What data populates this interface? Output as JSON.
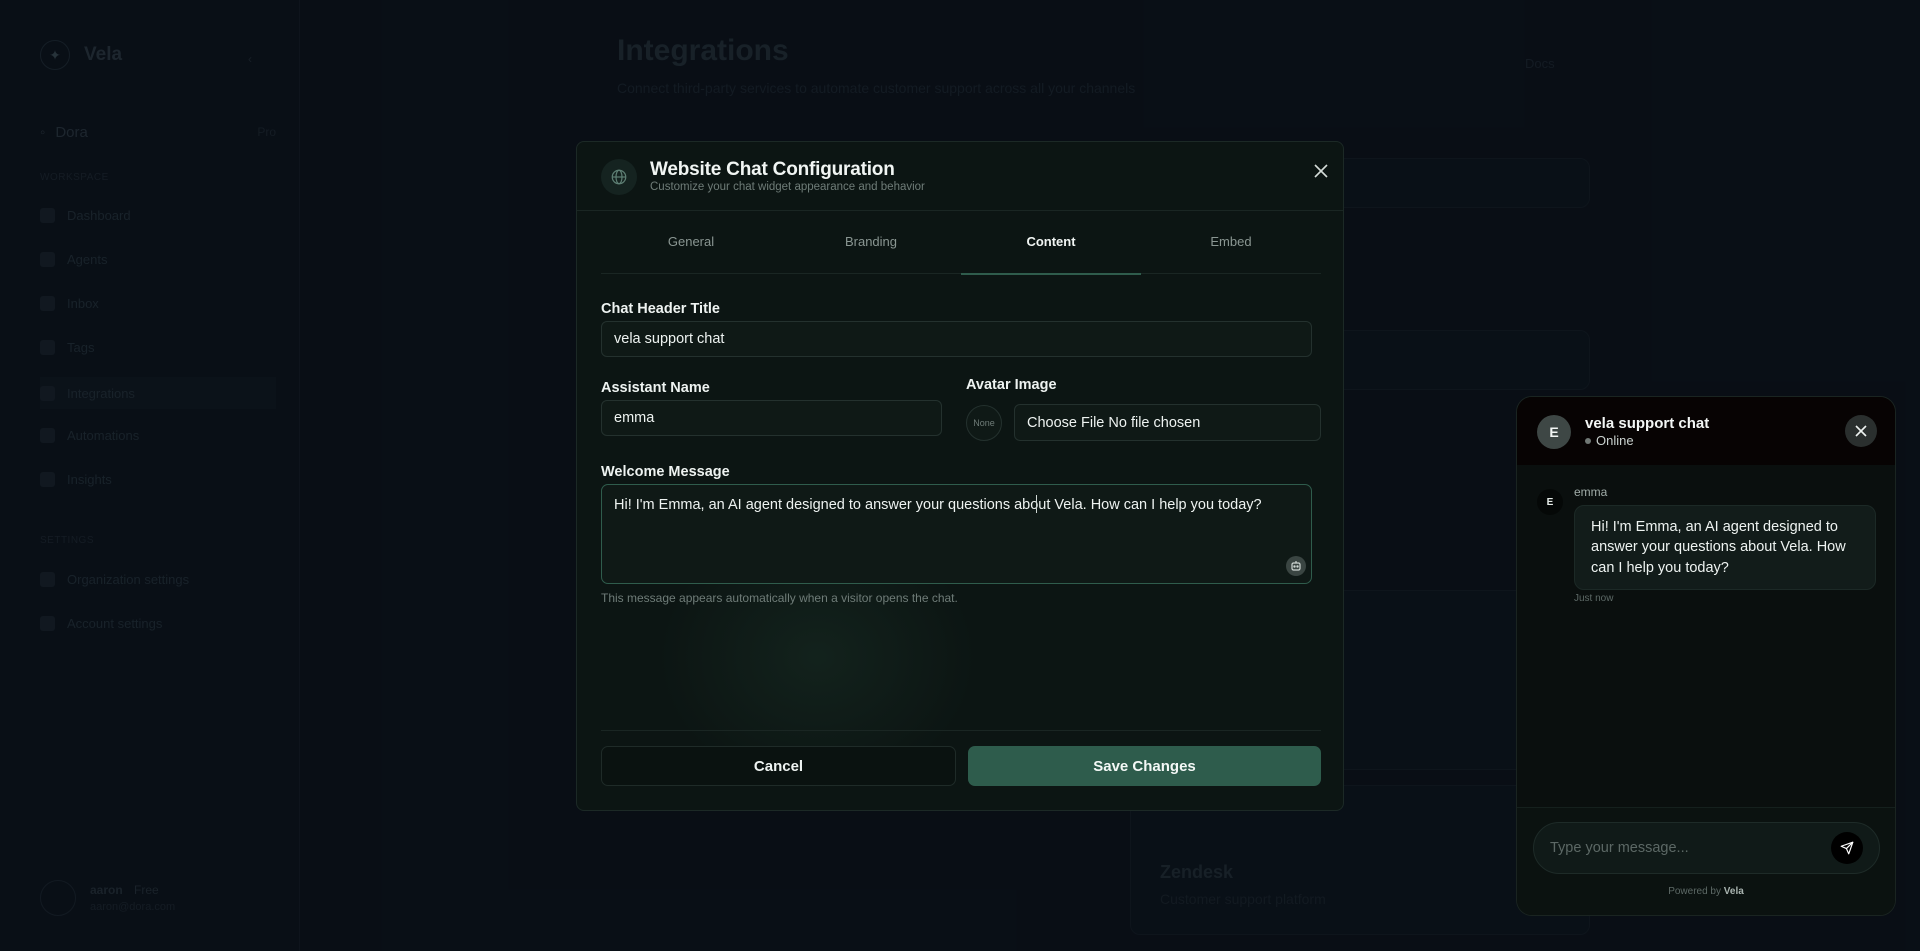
{
  "background": {
    "sidebar": {
      "brand": "Vela",
      "workspace": {
        "name": "Dora",
        "plan": "Pro"
      },
      "sections": [
        "WORKSPACE",
        "SETTINGS"
      ],
      "items": [
        "Dashboard",
        "Agents",
        "Inbox",
        "Tags",
        "Integrations",
        "Automations",
        "Insights"
      ],
      "settings_items": [
        "Organization settings",
        "Account settings"
      ],
      "user": {
        "name": "aaron",
        "plan": "Free",
        "email": "aaron@dora.com"
      }
    },
    "page": {
      "title": "Integrations",
      "subtitle": "Connect third-party services to automate customer support across all your channels",
      "action": "Docs",
      "card_title": "Zendesk",
      "card_desc": "Customer support platform"
    }
  },
  "modal": {
    "title": "Website Chat Configuration",
    "subtitle": "Customize your chat widget appearance and behavior",
    "tabs": [
      {
        "label": "General",
        "active": false
      },
      {
        "label": "Branding",
        "active": false
      },
      {
        "label": "Content",
        "active": true
      },
      {
        "label": "Embed",
        "active": false
      }
    ],
    "fields": {
      "chat_header_title": {
        "label": "Chat Header Title",
        "value": "vela support chat"
      },
      "assistant_name": {
        "label": "Assistant Name",
        "value": "emma"
      },
      "avatar_image": {
        "label": "Avatar Image",
        "placeholder": "None",
        "button": "Choose File",
        "status": "No file chosen"
      },
      "welcome_message": {
        "label": "Welcome Message",
        "value": "Hi! I'm Emma, an AI agent designed to answer your questions about Vela. How can I help you today?",
        "helper": "This message appears automatically when a visitor opens the chat."
      }
    },
    "buttons": {
      "cancel": "Cancel",
      "save": "Save Changes"
    }
  },
  "chat_preview": {
    "avatar_letter": "E",
    "title": "vela support chat",
    "status": "Online",
    "message": {
      "avatar_letter": "E",
      "sender": "emma",
      "text": "Hi! I'm Emma, an AI agent designed to answer your questions about Vela. How can I help you today?",
      "time": "Just now"
    },
    "input_placeholder": "Type your message...",
    "powered_by": "Powered by",
    "powered_brand": "Vela"
  },
  "colors": {
    "accent": "#2e5c4c",
    "modal_bg": "#0c1513",
    "page_bg": "#0b121a"
  }
}
